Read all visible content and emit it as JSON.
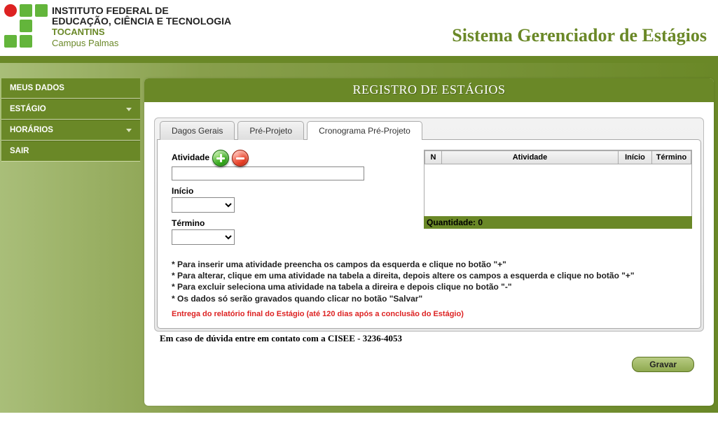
{
  "header": {
    "inst_line1": "INSTITUTO FEDERAL DE",
    "inst_line2": "EDUCAÇÃO, CIÊNCIA E TECNOLOGIA",
    "inst_line3": "TOCANTINS",
    "inst_line4": "Campus Palmas",
    "system_title": "Sistema Gerenciador de Estágios"
  },
  "sidebar": {
    "items": [
      {
        "label": "MEUS DADOS",
        "expandable": false
      },
      {
        "label": "ESTÁGIO",
        "expandable": true
      },
      {
        "label": "HORÁRIOS",
        "expandable": true
      },
      {
        "label": "SAIR",
        "expandable": false
      }
    ]
  },
  "content": {
    "title": "REGISTRO DE ESTÁGIOS",
    "tabs": [
      {
        "label": "Dagos Gerais",
        "active": false
      },
      {
        "label": "Pré-Projeto",
        "active": false
      },
      {
        "label": "Cronograma Pré-Projeto",
        "active": true
      }
    ],
    "form": {
      "atividade_label": "Atividade",
      "atividade_value": "",
      "inicio_label": "Início",
      "inicio_value": "",
      "termino_label": "Término",
      "termino_value": ""
    },
    "table": {
      "cols": {
        "n": "N",
        "atividade": "Atividade",
        "inicio": "Início",
        "termino": "Término"
      },
      "rows": [],
      "qty_label": "Quantidade:",
      "qty_value": "0"
    },
    "instructions": [
      "* Para inserir uma atividade preencha os campos da esquerda e clique no botão \"+\"",
      "* Para alterar, clique em uma atividade na tabela a direita, depois altere os campos a esquerda e clique no botão \"+\"",
      "* Para excluir seleciona uma atividade na tabela a direira e depois clique no botão \"-\"",
      "* Os dados só serão gravados quando clicar no botão \"Salvar\""
    ],
    "red_note": "Entrega do relatório final do Estágio (até 120 dias após a conclusão do Estágio)",
    "footer_help": "Em caso de dúvida entre em contato com a CISEE - 3236-4053",
    "save_label": "Gravar"
  }
}
